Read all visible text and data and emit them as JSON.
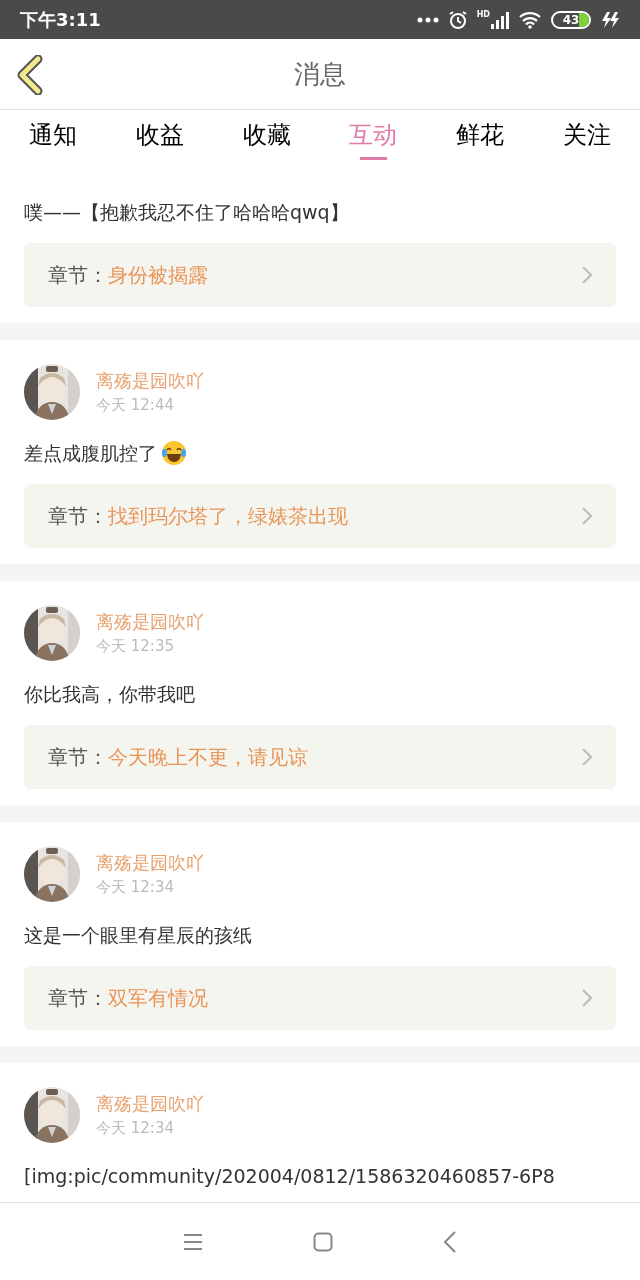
{
  "status_bar": {
    "time": "下午3:11",
    "network_label": "HD",
    "battery": "43"
  },
  "header": {
    "title": "消息"
  },
  "tabs": [
    {
      "label": "通知",
      "selected": false
    },
    {
      "label": "收益",
      "selected": false
    },
    {
      "label": "收藏",
      "selected": false
    },
    {
      "label": "互动",
      "selected": true
    },
    {
      "label": "鲜花",
      "selected": false
    },
    {
      "label": "关注",
      "selected": false
    }
  ],
  "messages": [
    {
      "text": "噗——【抱歉我忍不住了哈哈哈qwq】",
      "chapter_label": "章节：",
      "chapter": "身份被揭露"
    },
    {
      "user": "离殇是园吹吖",
      "time": "今天 12:44",
      "text": "差点成腹肌控了",
      "trailing_emoji": true,
      "chapter_label": "章节：",
      "chapter": "找到玛尔塔了，绿婊茶出现"
    },
    {
      "user": "离殇是园吹吖",
      "time": "今天 12:35",
      "text": "你比我高，你带我吧",
      "chapter_label": "章节：",
      "chapter": "今天晚上不更，请见谅"
    },
    {
      "user": "离殇是园吹吖",
      "time": "今天 12:34",
      "text": "这是一个眼里有星辰的孩纸",
      "chapter_label": "章节：",
      "chapter": "双军有情况"
    },
    {
      "user": "离殇是园吹吖",
      "time": "今天 12:34",
      "text": "[img:pic/community/202004/0812/1586320460857-6P8"
    }
  ]
}
